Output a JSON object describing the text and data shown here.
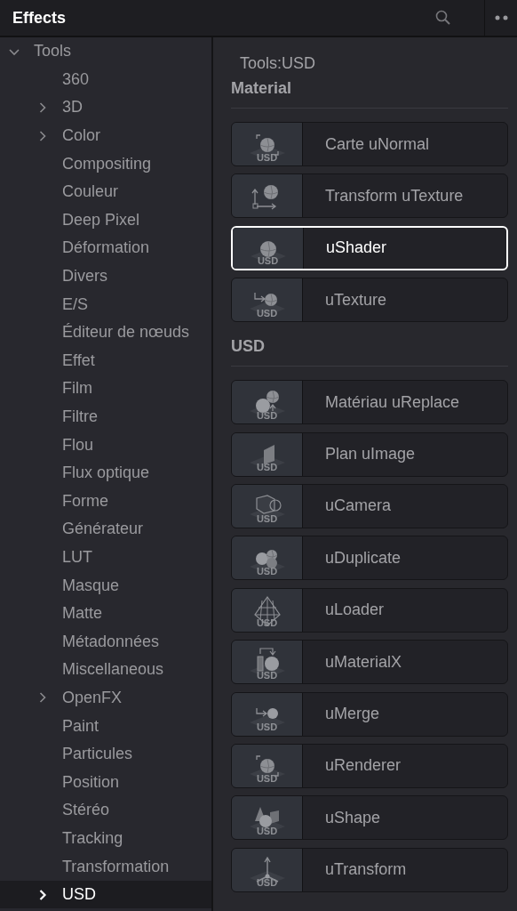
{
  "panel": {
    "title": "Effects"
  },
  "tree": [
    {
      "label": "Tools",
      "kind": "folder",
      "expanded": true,
      "selected": false,
      "children": [
        {
          "label": "360",
          "kind": "leaf",
          "selected": false
        },
        {
          "label": "3D",
          "kind": "folder",
          "expanded": false,
          "selected": false
        },
        {
          "label": "Color",
          "kind": "folder",
          "expanded": false,
          "selected": false
        },
        {
          "label": "Compositing",
          "kind": "leaf",
          "selected": false
        },
        {
          "label": "Couleur",
          "kind": "leaf",
          "selected": false
        },
        {
          "label": "Deep Pixel",
          "kind": "leaf",
          "selected": false
        },
        {
          "label": "Déformation",
          "kind": "leaf",
          "selected": false
        },
        {
          "label": "Divers",
          "kind": "leaf",
          "selected": false
        },
        {
          "label": "E/S",
          "kind": "leaf",
          "selected": false
        },
        {
          "label": "Éditeur de nœuds",
          "kind": "leaf",
          "selected": false
        },
        {
          "label": "Effet",
          "kind": "leaf",
          "selected": false
        },
        {
          "label": "Film",
          "kind": "leaf",
          "selected": false
        },
        {
          "label": "Filtre",
          "kind": "leaf",
          "selected": false
        },
        {
          "label": "Flou",
          "kind": "leaf",
          "selected": false
        },
        {
          "label": "Flux optique",
          "kind": "leaf",
          "selected": false
        },
        {
          "label": "Forme",
          "kind": "leaf",
          "selected": false
        },
        {
          "label": "Générateur",
          "kind": "leaf",
          "selected": false
        },
        {
          "label": "LUT",
          "kind": "leaf",
          "selected": false
        },
        {
          "label": "Masque",
          "kind": "leaf",
          "selected": false
        },
        {
          "label": "Matte",
          "kind": "leaf",
          "selected": false
        },
        {
          "label": "Métadonnées",
          "kind": "leaf",
          "selected": false
        },
        {
          "label": "Miscellaneous",
          "kind": "leaf",
          "selected": false
        },
        {
          "label": "OpenFX",
          "kind": "folder",
          "expanded": false,
          "selected": false
        },
        {
          "label": "Paint",
          "kind": "leaf",
          "selected": false
        },
        {
          "label": "Particules",
          "kind": "leaf",
          "selected": false
        },
        {
          "label": "Position",
          "kind": "leaf",
          "selected": false
        },
        {
          "label": "Stéréo",
          "kind": "leaf",
          "selected": false
        },
        {
          "label": "Tracking",
          "kind": "leaf",
          "selected": false
        },
        {
          "label": "Transformation",
          "kind": "leaf",
          "selected": false
        },
        {
          "label": "USD",
          "kind": "folder",
          "expanded": false,
          "selected": true
        }
      ]
    }
  ],
  "breadcrumb": "Tools:USD",
  "sections": [
    {
      "title": "Material",
      "tools": [
        {
          "label": "Carte uNormal",
          "kind": "frame-sphere",
          "badge": "USD",
          "selected": false
        },
        {
          "label": "Transform uTexture",
          "kind": "axes-sphere",
          "selected": false
        },
        {
          "label": "uShader",
          "kind": "sphere",
          "badge": "USD",
          "selected": true
        },
        {
          "label": "uTexture",
          "kind": "arrow-sphere",
          "badge": "USD",
          "selected": false
        }
      ]
    },
    {
      "title": "USD",
      "tools": [
        {
          "label": "Matériau uReplace",
          "kind": "spheres-arrow",
          "badge": "USD",
          "selected": false
        },
        {
          "label": "Plan uImage",
          "kind": "plane",
          "badge": "USD",
          "selected": false
        },
        {
          "label": "uCamera",
          "kind": "camera",
          "badge": "USD",
          "selected": false
        },
        {
          "label": "uDuplicate",
          "kind": "spheres",
          "badge": "USD",
          "selected": false
        },
        {
          "label": "uLoader",
          "kind": "mesh",
          "badge": "USD",
          "selected": false
        },
        {
          "label": "uMaterialX",
          "kind": "ball-arrow",
          "badge": "USD",
          "selected": false
        },
        {
          "label": "uMerge",
          "kind": "arrow-ball",
          "badge": "USD",
          "selected": false
        },
        {
          "label": "uRenderer",
          "kind": "frame-sphere",
          "badge": "USD",
          "selected": false
        },
        {
          "label": "uShape",
          "kind": "shapes",
          "badge": "USD",
          "selected": false
        },
        {
          "label": "uTransform",
          "kind": "axes3",
          "badge": "USD",
          "selected": false
        }
      ]
    }
  ]
}
